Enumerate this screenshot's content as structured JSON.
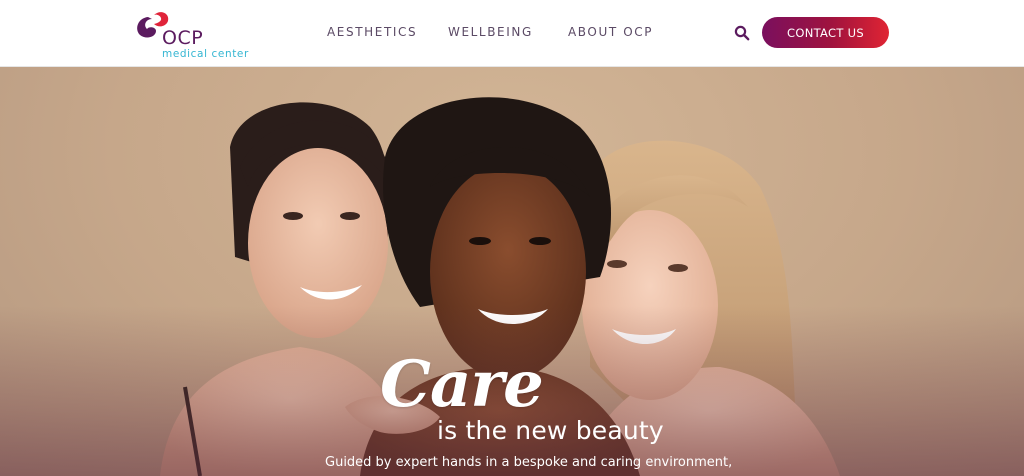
{
  "brand": {
    "name": "OCP",
    "tagline": "medical center",
    "colors": {
      "primary": "#5b1b5f",
      "accent": "#35b6d2",
      "cta_start": "#7a0f5e",
      "cta_end": "#e02433"
    }
  },
  "nav": {
    "items": [
      {
        "label": "AESTHETICS"
      },
      {
        "label": "WELLBEING"
      },
      {
        "label": "ABOUT OCP"
      }
    ],
    "search_icon": "search-icon",
    "contact_label": "CONTACT US"
  },
  "hero": {
    "script_word": "Care",
    "title": "is the new beauty",
    "subtitle": "Guided by expert hands in a bespoke and caring environment,",
    "image": "three smiling women portrait"
  }
}
